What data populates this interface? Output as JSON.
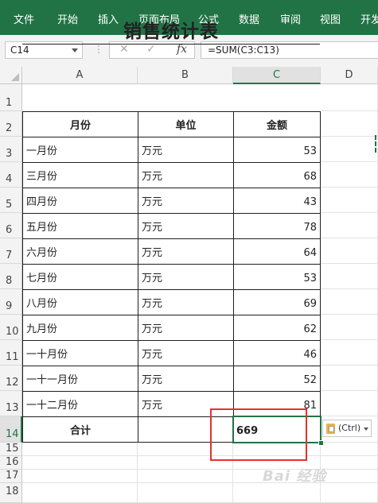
{
  "ribbon": {
    "tabs": [
      "文件",
      "开始",
      "插入",
      "页面布局",
      "公式",
      "数据",
      "审阅",
      "视图",
      "开发"
    ]
  },
  "formula_bar": {
    "name_box": "C14",
    "fx_label": "fx",
    "formula": "=SUM(C3:C13)"
  },
  "columns": [
    "A",
    "B",
    "C",
    "D"
  ],
  "rows": [
    "1",
    "2",
    "3",
    "4",
    "5",
    "6",
    "7",
    "8",
    "9",
    "10",
    "11",
    "12",
    "13",
    "14",
    "15",
    "16",
    "17",
    "18"
  ],
  "sheet": {
    "title": "销售统计表",
    "headers": [
      "月份",
      "单位",
      "金额"
    ],
    "data": [
      {
        "month": "一月份",
        "unit": "万元",
        "amount": "53"
      },
      {
        "month": "三月份",
        "unit": "万元",
        "amount": "68"
      },
      {
        "month": "四月份",
        "unit": "万元",
        "amount": "43"
      },
      {
        "month": "五月份",
        "unit": "万元",
        "amount": "78"
      },
      {
        "month": "六月份",
        "unit": "万元",
        "amount": "64"
      },
      {
        "month": "七月份",
        "unit": "万元",
        "amount": "53"
      },
      {
        "month": "八月份",
        "unit": "万元",
        "amount": "69"
      },
      {
        "month": "九月份",
        "unit": "万元",
        "amount": "62"
      },
      {
        "month": "一十月份",
        "unit": "万元",
        "amount": "46"
      },
      {
        "month": "一十一月份",
        "unit": "万元",
        "amount": "52"
      },
      {
        "month": "一十二月份",
        "unit": "万元",
        "amount": "81"
      }
    ],
    "total_label": "合计",
    "total_value": "669"
  },
  "paste_options": {
    "label": "(Ctrl)"
  },
  "watermark": "Bai 经验",
  "colors": {
    "accent": "#217346",
    "highlight_box": "#e8302a"
  }
}
